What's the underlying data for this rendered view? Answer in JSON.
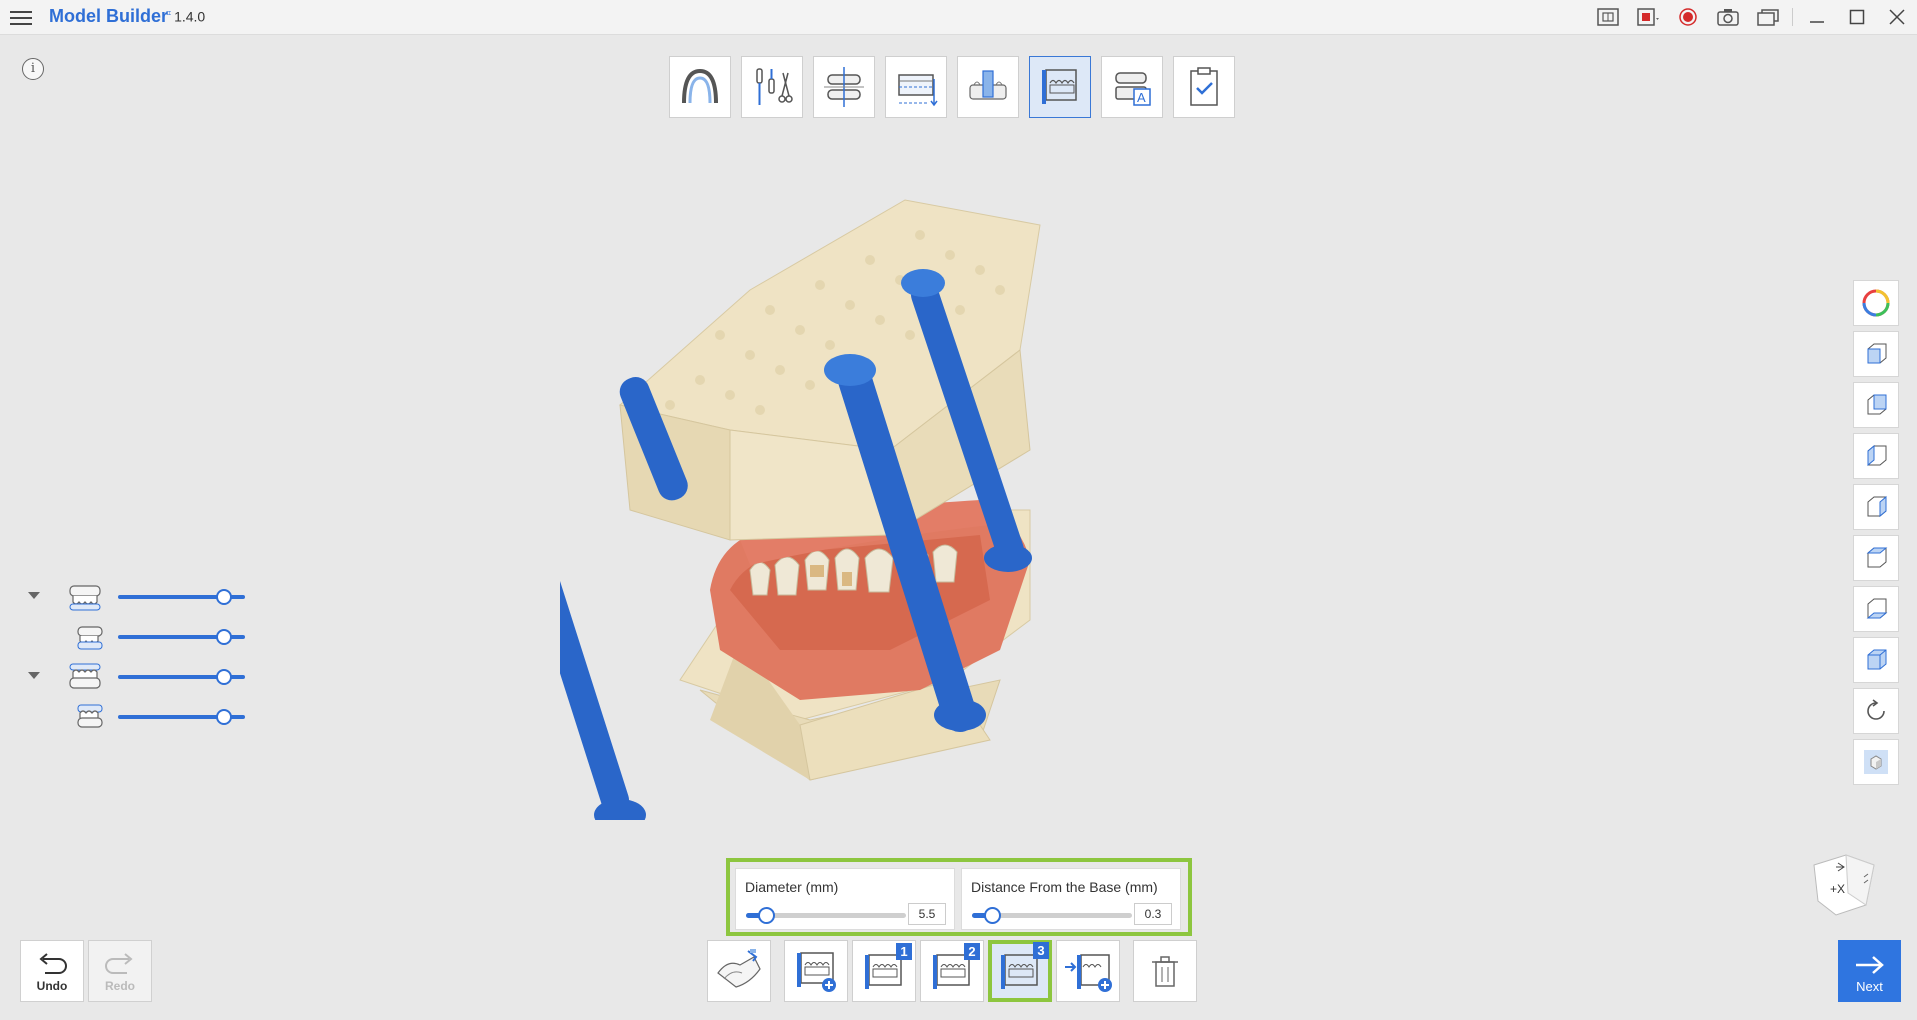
{
  "app": {
    "title": "Model Builder",
    "version_mark": "⌗",
    "version": "1.4.0"
  },
  "titlebar": {
    "icons": [
      "layout-icon",
      "record-area-icon",
      "record-icon",
      "camera-icon",
      "screens-icon",
      "minimize-icon",
      "maximize-icon",
      "close-icon"
    ]
  },
  "info": {
    "label": "i"
  },
  "stepper": {
    "active_index": 5,
    "steps": [
      "arch-icon",
      "tools-cut-icon",
      "occlusal-plane-icon",
      "base-height-icon",
      "tooth-die-icon",
      "model-base-icon",
      "label-icon",
      "checklist-icon"
    ]
  },
  "layers": [
    {
      "name": "upper-jaw-model",
      "expandable": true,
      "opacity": 1.0
    },
    {
      "name": "upper-jaw-scan",
      "expandable": false,
      "opacity": 1.0
    },
    {
      "name": "lower-jaw-model",
      "expandable": true,
      "opacity": 1.0
    },
    {
      "name": "lower-jaw-scan",
      "expandable": false,
      "opacity": 1.0
    }
  ],
  "view_toolbar": [
    "color-wheel-icon",
    "front-view-icon",
    "back-view-icon",
    "left-view-icon",
    "right-view-icon",
    "top-view-icon",
    "bottom-view-icon",
    "iso-view-icon",
    "reset-rotation-icon",
    "solid-view-icon"
  ],
  "navcube": {
    "face_label": "+X"
  },
  "settings": {
    "diameter": {
      "label": "Diameter (mm)",
      "value": "5.5",
      "position": 0.12
    },
    "distance": {
      "label": "Distance From the Base (mm)",
      "value": "0.3",
      "position": 0.12
    }
  },
  "undo": {
    "label": "Undo"
  },
  "redo": {
    "label": "Redo"
  },
  "bottom_tools": [
    {
      "name": "flip-model",
      "badge": ""
    },
    {
      "name": "add-connector",
      "badge": ""
    },
    {
      "name": "connector-1",
      "badge": "1"
    },
    {
      "name": "connector-2",
      "badge": "2"
    },
    {
      "name": "connector-3",
      "badge": "3",
      "active": true
    },
    {
      "name": "insert-connector",
      "badge": ""
    },
    {
      "name": "delete",
      "badge": ""
    }
  ],
  "next": {
    "label": "Next"
  }
}
